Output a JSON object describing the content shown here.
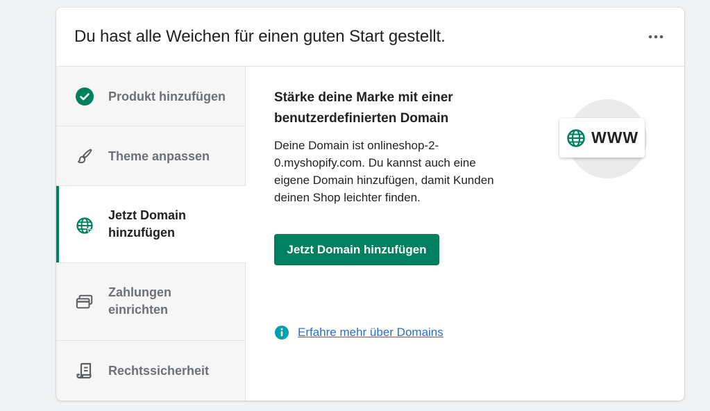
{
  "header": {
    "title": "Du hast alle Weichen für einen guten Start gestellt.",
    "more_icon": "horizontal-dots-icon"
  },
  "sidebar": {
    "steps": [
      {
        "label": "Produkt hinzufügen",
        "icon": "check-circle-icon",
        "state": "completed"
      },
      {
        "label": "Theme anpassen",
        "icon": "paintbrush-icon",
        "state": "pending"
      },
      {
        "label": "Jetzt Domain hinzufügen",
        "icon": "globe-icon",
        "state": "active"
      },
      {
        "label": "Zahlungen einrichten",
        "icon": "credit-card-icon",
        "state": "pending"
      },
      {
        "label": "Rechtssicherheit",
        "icon": "legal-document-icon",
        "state": "pending"
      }
    ]
  },
  "content": {
    "title": "Stärke deine Marke mit einer benutzerdefinierten Domain",
    "description": "Deine Domain ist onlineshop-2-0.myshopify.com. Du kannst auch eine eigene Domain hinzufügen, damit Kunden deinen Shop leichter finden.",
    "primary_button": "Jetzt Domain hinzufügen",
    "learn_more_link": "Erfahre mehr über Domains",
    "learn_more_icon": "info-circle-icon",
    "illustration": {
      "text": "WWW",
      "icon": "globe-icon"
    }
  },
  "colors": {
    "primary": "#008060",
    "link": "#2c6ecb",
    "info": "#00a0ac",
    "muted_text": "#6d7175",
    "text": "#202223",
    "sidebar_bg": "#f6f6f7"
  }
}
